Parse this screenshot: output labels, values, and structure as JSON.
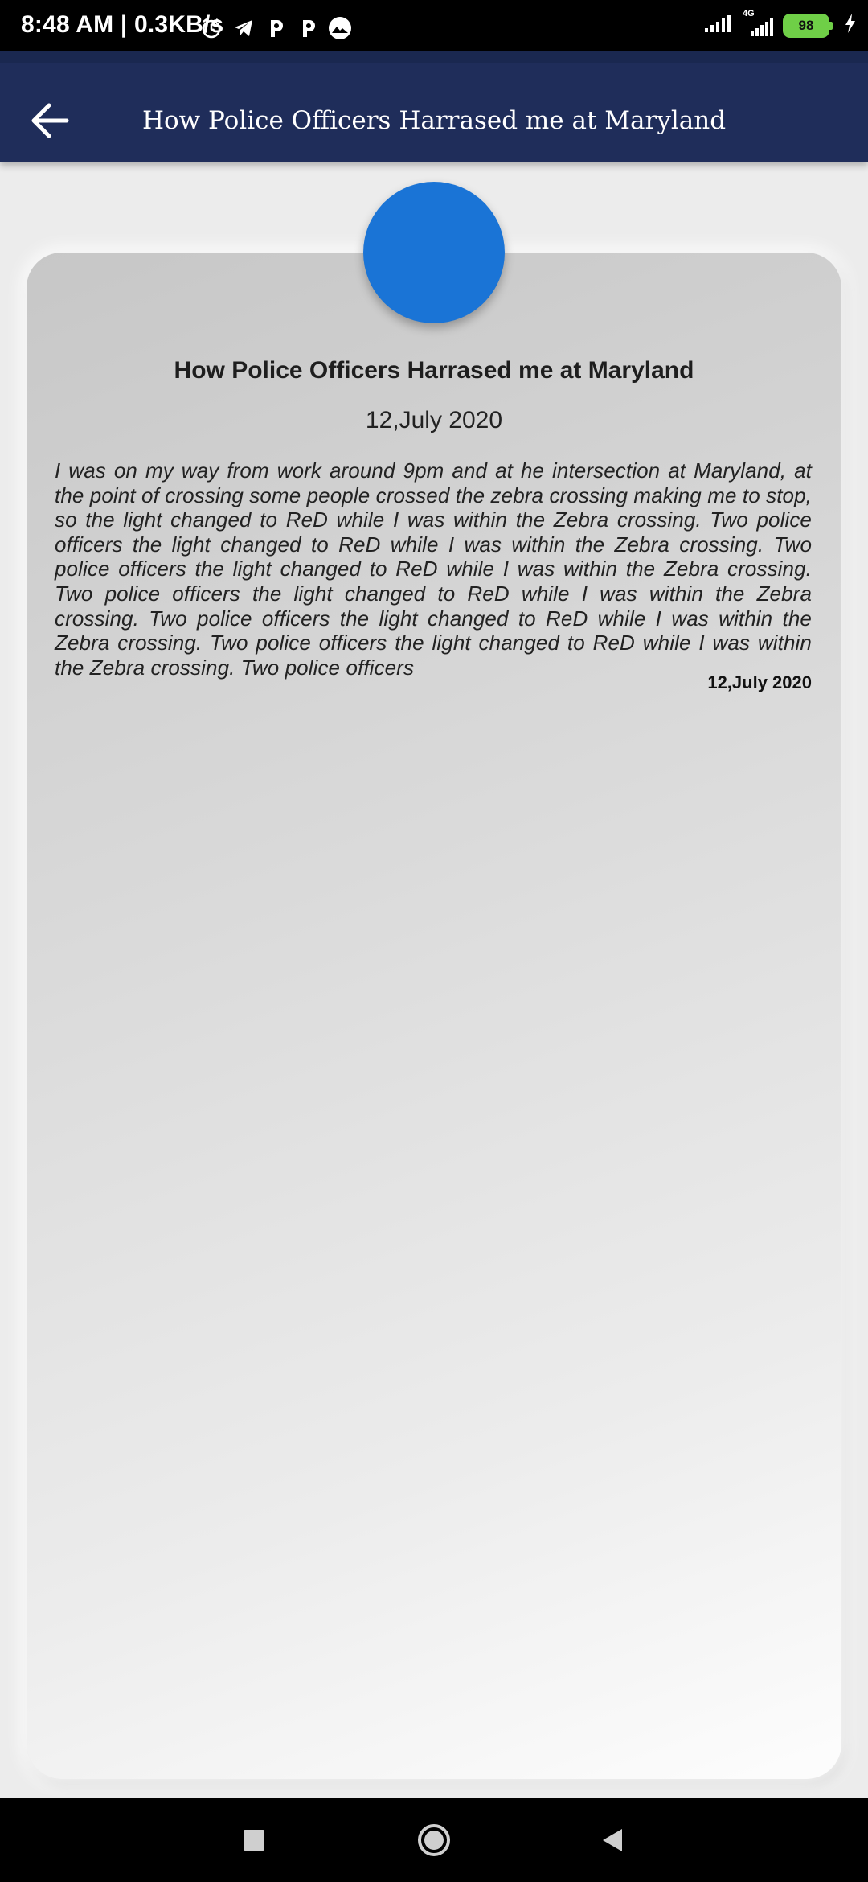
{
  "status_bar": {
    "time_speed": "8:48 AM | 0.3KB/s",
    "icons": [
      "alarm-icon",
      "telegram-icon",
      "p-app-icon",
      "p-app-icon",
      "mountain-app-icon"
    ],
    "right_icons": [
      "signal-icon",
      "4g-signal-icon"
    ],
    "network_label": "4G",
    "battery": "98"
  },
  "app_bar": {
    "title": "How Police Officers Harrased me at Maryland"
  },
  "card": {
    "title": "How Police Officers Harrased me at Maryland",
    "date": "12,July 2020",
    "body": "I was on my way from work around 9pm and at he intersection at Maryland, at the point of crossing some people crossed the zebra crossing making me to stop, so the light changed to ReD while I was within the Zebra crossing. Two police officers the light changed to ReD while I was within the Zebra crossing. Two police officers the light changed to ReD while I was within the Zebra crossing. Two police officers the light changed to ReD while I was within the Zebra crossing. Two police officers the light changed to ReD while I was within the Zebra crossing. Two police officers the light changed to ReD while I was within the Zebra crossing. Two police officers",
    "footer_date": "12,July 2020",
    "avatar_color": "#1a74d6"
  },
  "colors": {
    "app_bar": "#1f2d5a",
    "battery": "#6fcf47"
  },
  "nav_bar": {
    "buttons": [
      "recents-square-icon",
      "home-circle-icon",
      "back-triangle-icon"
    ]
  }
}
